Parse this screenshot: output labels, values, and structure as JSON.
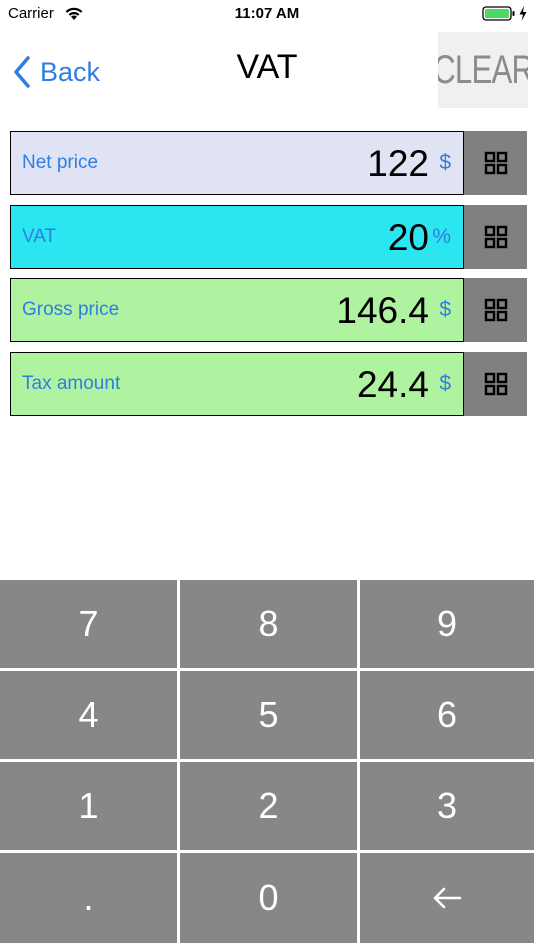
{
  "status_bar": {
    "carrier": "Carrier",
    "time": "11:07 AM",
    "wifi_icon": "wifi-icon",
    "battery_icon": "battery-icon",
    "charging_icon": "charging-bolt-icon"
  },
  "nav": {
    "back_label": "Back",
    "back_icon": "chevron-left-icon",
    "title": "VAT",
    "clear_label": "CLEAR"
  },
  "fields": [
    {
      "label": "Net price",
      "value": "122",
      "unit": "$",
      "bg": "#dfe3f3"
    },
    {
      "label": "VAT",
      "value": "20",
      "unit": "%",
      "bg": "#2be5f0"
    },
    {
      "label": "Gross price",
      "value": "146.4",
      "unit": "$",
      "bg": "#aff2a0"
    },
    {
      "label": "Tax amount",
      "value": "24.4",
      "unit": "$",
      "bg": "#aff2a0"
    }
  ],
  "keypad": {
    "keys": [
      "7",
      "8",
      "9",
      "4",
      "5",
      "6",
      "1",
      "2",
      "3",
      ".",
      "0"
    ],
    "backspace_icon": "backspace-arrow-icon"
  },
  "colors": {
    "accent": "#2f7fe0",
    "key_bg": "#878787",
    "grid_button_bg": "#808080",
    "battery_green": "#4cd964"
  }
}
